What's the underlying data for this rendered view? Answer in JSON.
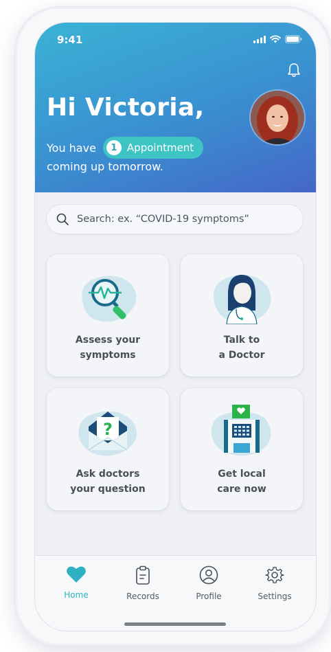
{
  "status_bar": {
    "time": "9:41"
  },
  "header": {
    "greeting": "Hi Victoria,",
    "line1_prefix": "You have",
    "appointment_count": "1",
    "appointment_label": "Appointment",
    "line2": "coming up tomorrow."
  },
  "search": {
    "placeholder": "Search: ex. “COVID-19 symptoms”"
  },
  "cards": [
    {
      "line1": "Assess your",
      "line2": "symptoms"
    },
    {
      "line1": "Talk to",
      "line2": "a Doctor"
    },
    {
      "line1": "Ask doctors",
      "line2": "your question"
    },
    {
      "line1": "Get local",
      "line2": "care now"
    }
  ],
  "nav": {
    "items": [
      {
        "label": "Home",
        "icon": "heart-icon",
        "active": true
      },
      {
        "label": "Records",
        "icon": "clipboard-icon",
        "active": false
      },
      {
        "label": "Profile",
        "icon": "user-icon",
        "active": false
      },
      {
        "label": "Settings",
        "icon": "gear-icon",
        "active": false
      }
    ]
  },
  "colors": {
    "header_gradient_start": "#3ab3d6",
    "header_gradient_end": "#4567c8",
    "accent_teal": "#2fb0c3",
    "pill_bg": "#3fc4c4"
  }
}
